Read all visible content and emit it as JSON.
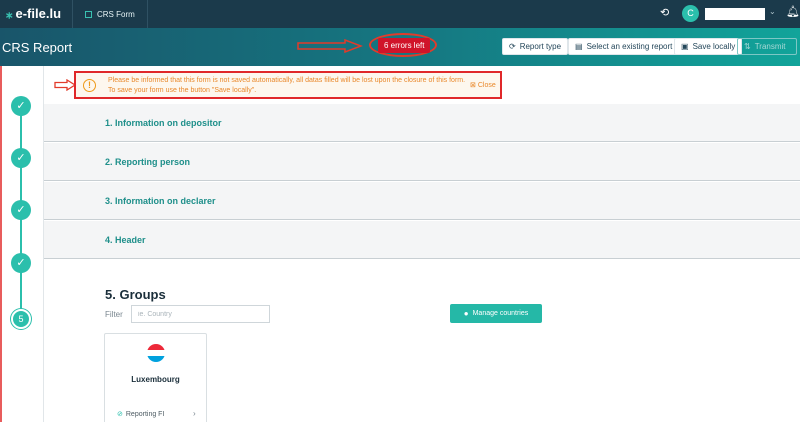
{
  "topbar": {
    "logo": "e-file.lu",
    "tab": "CRS Form",
    "avatar_initial": "C",
    "user_chevron": "⌄",
    "icons": [
      "sync-icon",
      "bell-icon"
    ]
  },
  "header": {
    "title": "CRS Report",
    "errors_badge": "6 errors left",
    "buttons": {
      "report_type": "Report type",
      "select_existing": "Select an existing report",
      "save_locally": "Save locally",
      "transmit": "Transmit"
    }
  },
  "warning": {
    "icon": "!",
    "text": "Please be informed that this form is not saved automatically, all datas filled will be lost upon the closure of this form. To save your form use the button \"Save locally\".",
    "close": "Close"
  },
  "steps": {
    "done_symbol": "✓",
    "current": "5"
  },
  "sections": {
    "s1": "1. Information on depositor",
    "s2": "2. Reporting person",
    "s3": "3. Information on declarer",
    "s4": "4. Header"
  },
  "groups": {
    "title": "5. Groups",
    "filter_label": "Filter",
    "filter_placeholder": "ie. Country",
    "manage_button": "Manage countries",
    "card": {
      "country": "Luxembourg",
      "reporting": "Reporting FI",
      "chevron": "›"
    }
  },
  "colors": {
    "topbar": "#1b3a4b",
    "accent": "#2bbfac",
    "error": "#d0142a",
    "warning_text": "#e9882b",
    "section_label": "#1e8f8a"
  }
}
